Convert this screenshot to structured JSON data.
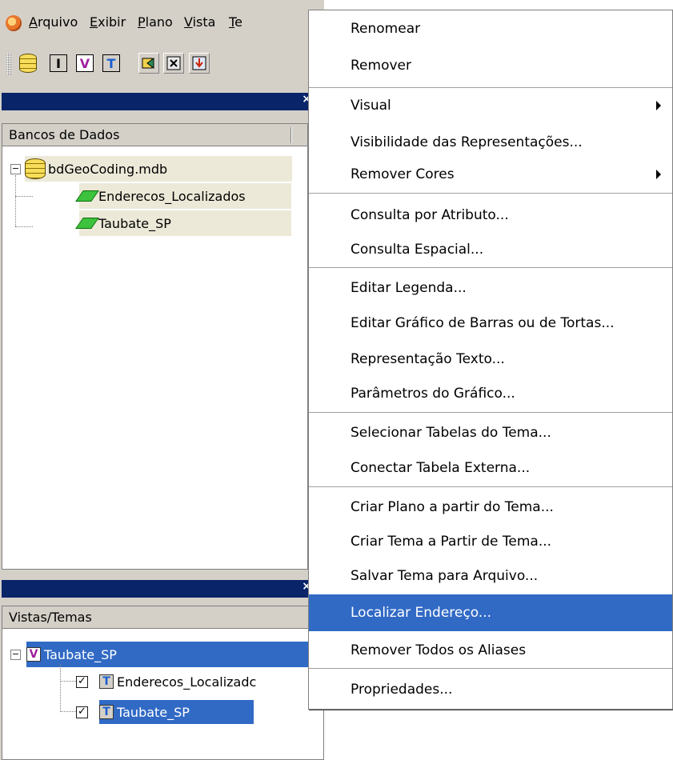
{
  "menubar": {
    "items": [
      "Arquivo",
      "Exibir",
      "Plano",
      "Vista",
      "Te"
    ],
    "mnemonics": [
      "A",
      "E",
      "P",
      "V",
      "T"
    ]
  },
  "toolbar": {
    "buttons": [
      {
        "name": "database-icon",
        "label": ""
      },
      {
        "name": "info-letter-icon",
        "label": "I"
      },
      {
        "name": "view-letter-icon",
        "label": "V"
      },
      {
        "name": "theme-letter-icon",
        "label": "T"
      },
      {
        "name": "tool-1-icon",
        "label": ""
      },
      {
        "name": "tool-2-icon",
        "label": ""
      },
      {
        "name": "tool-3-icon",
        "label": ""
      }
    ]
  },
  "databases": {
    "header": "Bancos de Dados",
    "db_name": "bdGeoCoding.mdb",
    "layers": [
      "Enderecos_Localizados",
      "Taubate_SP"
    ]
  },
  "views": {
    "header": "Vistas/Temas",
    "view_name": "Taubate_SP",
    "themes": [
      {
        "label": "Enderecos_Localizados",
        "checked": true,
        "visible_text": "Enderecos_Localizadc"
      },
      {
        "label": "Taubate_SP",
        "checked": true
      }
    ]
  },
  "context_menu": {
    "items": [
      {
        "label": "Renomear"
      },
      {
        "label": "Remover"
      },
      {
        "label": "Visual",
        "submenu": true
      },
      {
        "label": "Visibilidade das Representações..."
      },
      {
        "label": "Remover Cores",
        "submenu": true
      },
      {
        "label": "Consulta por Atributo..."
      },
      {
        "label": "Consulta Espacial..."
      },
      {
        "label": "Editar Legenda..."
      },
      {
        "label": "Editar Gráfico de Barras ou de Tortas..."
      },
      {
        "label": "Representação Texto..."
      },
      {
        "label": "Parâmetros do Gráfico..."
      },
      {
        "label": "Selecionar Tabelas do Tema..."
      },
      {
        "label": "Conectar Tabela Externa..."
      },
      {
        "label": "Criar Plano a partir do Tema..."
      },
      {
        "label": "Criar Tema a Partir de Tema..."
      },
      {
        "label": "Salvar Tema para Arquivo..."
      },
      {
        "label": "Localizar Endereço...",
        "highlighted": true
      },
      {
        "label": "Remover Todos os Aliases"
      },
      {
        "label": "Propriedades..."
      }
    ]
  },
  "colors": {
    "selection": "#316ac5",
    "titlebar": "#0a246a",
    "face": "#d4d0c8"
  }
}
